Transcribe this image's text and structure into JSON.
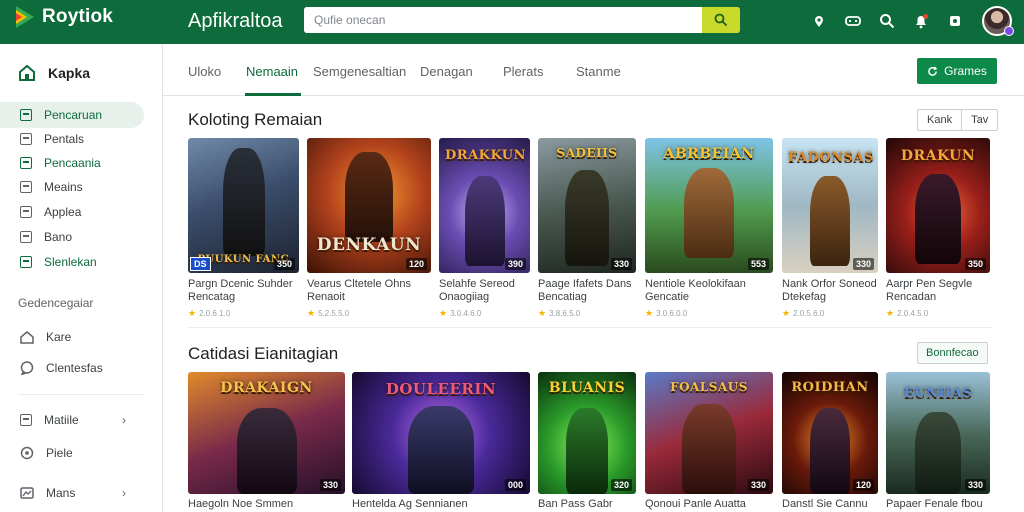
{
  "brand": {
    "name": "Roytiok"
  },
  "header": {
    "app_title": "Apfikraltoa",
    "search_placeholder": "Qufie onecan"
  },
  "sidebar": {
    "heading": "Kapka",
    "items": [
      {
        "label": "Pencaruan",
        "active": true
      },
      {
        "label": "Pentals"
      },
      {
        "label": "Pencaania"
      },
      {
        "label": "Meains"
      },
      {
        "label": "Applea"
      },
      {
        "label": "Bano"
      },
      {
        "label": "Slenlekan"
      }
    ],
    "sub_heading": "Gedencegaiar",
    "lower_items": [
      {
        "label": "Kare"
      },
      {
        "label": "Clentesfas"
      },
      {
        "label": "Matiile"
      },
      {
        "label": "Piele"
      },
      {
        "label": "Mans"
      }
    ]
  },
  "tabs": [
    {
      "label": "Uloko"
    },
    {
      "label": "Nemaain",
      "active": true
    },
    {
      "label": "Semgenesaltian"
    },
    {
      "label": "Denagan"
    },
    {
      "label": "Plerats"
    },
    {
      "label": "Stanme"
    }
  ],
  "cta": {
    "label": "Grames"
  },
  "section1": {
    "title": "Koloting Remaian",
    "pills": [
      "Kank",
      "Tav"
    ],
    "cards": [
      {
        "cover_text": "Puukun fang",
        "num": "350",
        "badge": "DS",
        "title_line1": "Pargn Dcenic Suhder",
        "title_line2": "Rencatag",
        "rating": "2.0.6.1.0"
      },
      {
        "cover_text": "Denkaun",
        "num": "120",
        "title_line1": "Vearus Cltetele Ohns",
        "title_line2": "Renaoit",
        "rating": "5.2.5.5.0"
      },
      {
        "cover_text": "Drakkun",
        "num": "390",
        "title_line1": "Selahfe Sereod",
        "title_line2": "Onaogiiag",
        "rating": "3.0.4.6.0"
      },
      {
        "cover_text": "Sadeiis",
        "num": "330",
        "title_line1": "Paage Ifafets Dans",
        "title_line2": "Bencatiag",
        "rating": "3.8.6.5.0"
      },
      {
        "cover_text": "Abrbeian",
        "num": "553",
        "title_line1": "Nentiole Keolokifaan",
        "title_line2": "Gencatie",
        "rating": "3.0.6.0.0"
      },
      {
        "cover_text": "Fadonsas",
        "num": "330",
        "title_line1": "Nank Orfor Soneod",
        "title_line2": "Dtekefag",
        "rating": "2.0.5.6.0"
      },
      {
        "cover_text": "Drakun",
        "num": "350",
        "title_line1": "Aarpr Pen Segvle",
        "title_line2": "Rencadan",
        "rating": "2.0.4.5.0"
      }
    ]
  },
  "section2": {
    "title": "Catidasi Eianitagian",
    "pill": "Bonnfecao",
    "cards": [
      {
        "cover_text": "Drakaign",
        "num": "330",
        "title": "Haegoln Noe Smmen"
      },
      {
        "cover_text": "Douleerin",
        "num": "000",
        "title": "Hentelda Ag Sennianen"
      },
      {
        "cover_text": "Bluanis",
        "num": "320",
        "title": "Ban Pass Gabr"
      },
      {
        "cover_text": "Foalsaus",
        "num": "330",
        "title": "Qonoui Panle Auatta"
      },
      {
        "cover_text": "Roidhan",
        "num": "120",
        "title": "Danstl Sie Cannu"
      },
      {
        "cover_text": "Euniias",
        "num": "330",
        "title": "Papaer Fenale fbou"
      }
    ]
  },
  "colors": {
    "primary": "#0d6b3c",
    "accent": "#c8d92a",
    "cta": "#0d8a4a"
  }
}
